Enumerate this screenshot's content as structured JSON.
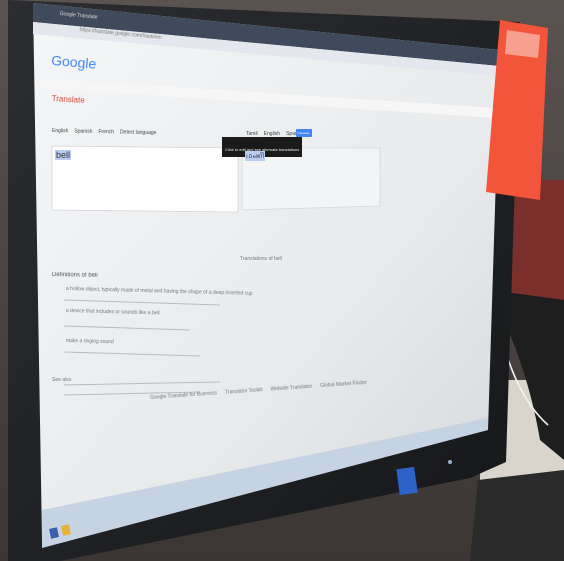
{
  "browser": {
    "tab_title": "Google Translate",
    "address_url": "https://translate.google.com/#auto/en"
  },
  "page": {
    "logo_text": "Google",
    "section_title": "Translate"
  },
  "source": {
    "language_tabs": [
      "English",
      "Spanish",
      "French",
      "Detect language"
    ],
    "text": "bell"
  },
  "target": {
    "language_tabs": [
      "Tamil",
      "English",
      "Spanish"
    ],
    "translate_button": "Translate",
    "tooltip": "Click to edit and see alternate translations",
    "text": "மணி"
  },
  "definitions": {
    "heading": "Definitions of bell",
    "entries": [
      "a hollow object, typically made of metal and having the shape of a deep inverted cup",
      "a device that includes or sounds like a bell",
      "make a ringing sound"
    ]
  },
  "translations_heading": "Translations of bell",
  "see_also": "See also",
  "footer_links": [
    "Google Translate for Business",
    "Translator Toolkit",
    "Website Translator",
    "Global Market Finder"
  ],
  "colors": {
    "screen_bg": "#eef0f1",
    "google_blue": "#4285f4",
    "translate_red": "#dd4b39",
    "sticker_orange": "#f2553a",
    "taskbar": "#c6d3e3"
  }
}
